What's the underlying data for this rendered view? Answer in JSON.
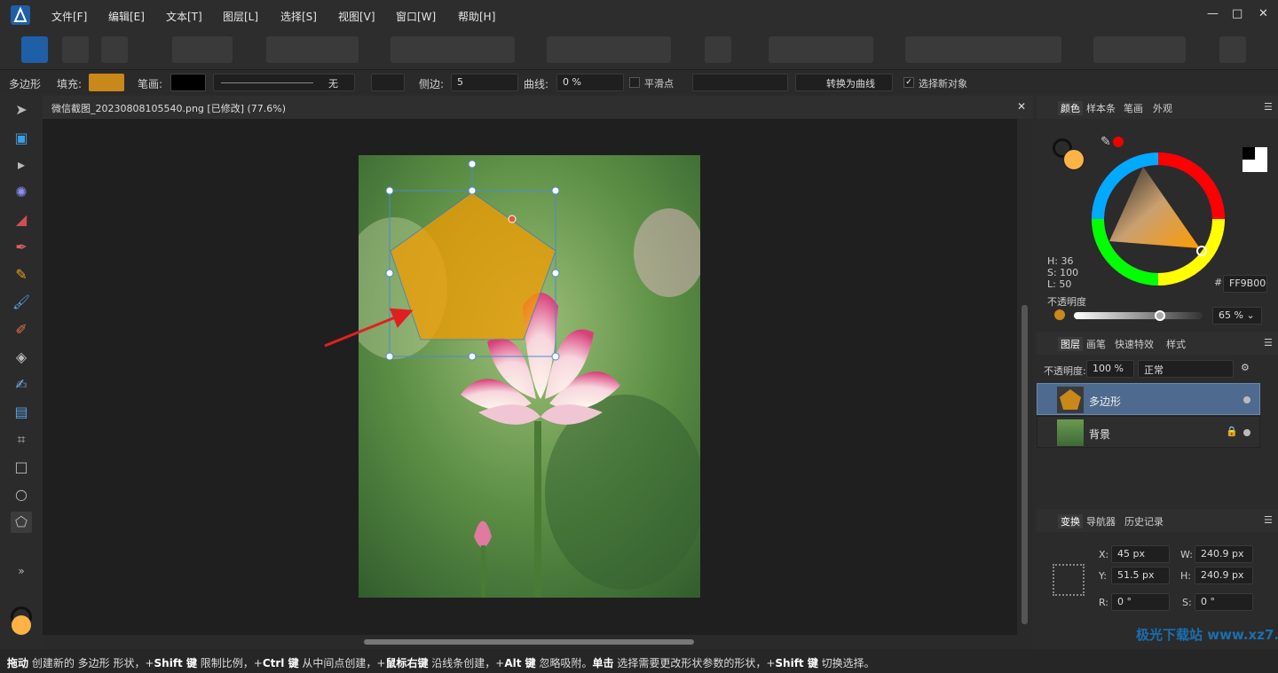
{
  "app": {
    "name": "Affinity Designer"
  },
  "menu": [
    "文件[F]",
    "编辑[E]",
    "文本[T]",
    "图层[L]",
    "选择[S]",
    "视图[V]",
    "窗口[W]",
    "帮助[H]"
  ],
  "window_controls": {
    "minimize": "—",
    "maximize": "□",
    "close": "✕"
  },
  "context": {
    "shape_label": "多边形",
    "fill_label": "填充:",
    "fill_color": "#c8881a",
    "stroke_label": "笔画:",
    "stroke_color": "#000000",
    "stroke_value": "无",
    "sides_label": "侧边:",
    "sides_value": "5",
    "curve_label": "曲线:",
    "curve_value": "0 %",
    "smooth_label": "平滑点",
    "convert_label": "转换为曲线",
    "select_new_label": "选择新对象"
  },
  "document": {
    "tab_title": "微信截图_20230808105540.png [已修改] (77.6%)",
    "close": "✕"
  },
  "status": {
    "text_parts": [
      {
        "b": "拖动"
      },
      {
        "t": " 创建新的 多边形 形状，+"
      },
      {
        "b": "Shift 键"
      },
      {
        "t": " 限制比例，+"
      },
      {
        "b": "Ctrl 键"
      },
      {
        "t": " 从中间点创建，+"
      },
      {
        "b": "鼠标右键"
      },
      {
        "t": " 沿线条创建，+"
      },
      {
        "b": "Alt 键"
      },
      {
        "t": " 忽略吸附。"
      },
      {
        "b": "单击"
      },
      {
        "t": " 选择需要更改形状参数的形状，+"
      },
      {
        "b": "Shift 键"
      },
      {
        "t": " 切换选择。"
      }
    ]
  },
  "color_panel": {
    "tabs": [
      "颜色",
      "样本条",
      "笔画",
      "外观"
    ],
    "hsl": {
      "h": "H: 36",
      "s": "S: 100",
      "l": "L: 50"
    },
    "hex_label": "#:",
    "hex": "FF9B00",
    "opacity_label": "不透明度",
    "opacity": "65 %",
    "opacity_value": 0.65,
    "fill_swatch": "#ffb347"
  },
  "layers_panel": {
    "tabs": [
      "图层",
      "画笔",
      "快速特效",
      "样式"
    ],
    "opacity_label": "不透明度:",
    "opacity": "100 %",
    "blend": "正常",
    "layers": [
      {
        "name": "多边形",
        "selected": true
      },
      {
        "name": "背景",
        "selected": false
      }
    ]
  },
  "transform_panel": {
    "tabs": [
      "变换",
      "导航器",
      "历史记录"
    ],
    "x_label": "X:",
    "x": "45 px",
    "y_label": "Y:",
    "y": "51.5 px",
    "w_label": "W:",
    "w": "240.9 px",
    "h_label": "H:",
    "h": "240.9 px",
    "r_label": "R:",
    "r": "0 °",
    "s_label": "S:",
    "s": "0 °"
  },
  "watermark": "极光下载站 www.xz7.com"
}
